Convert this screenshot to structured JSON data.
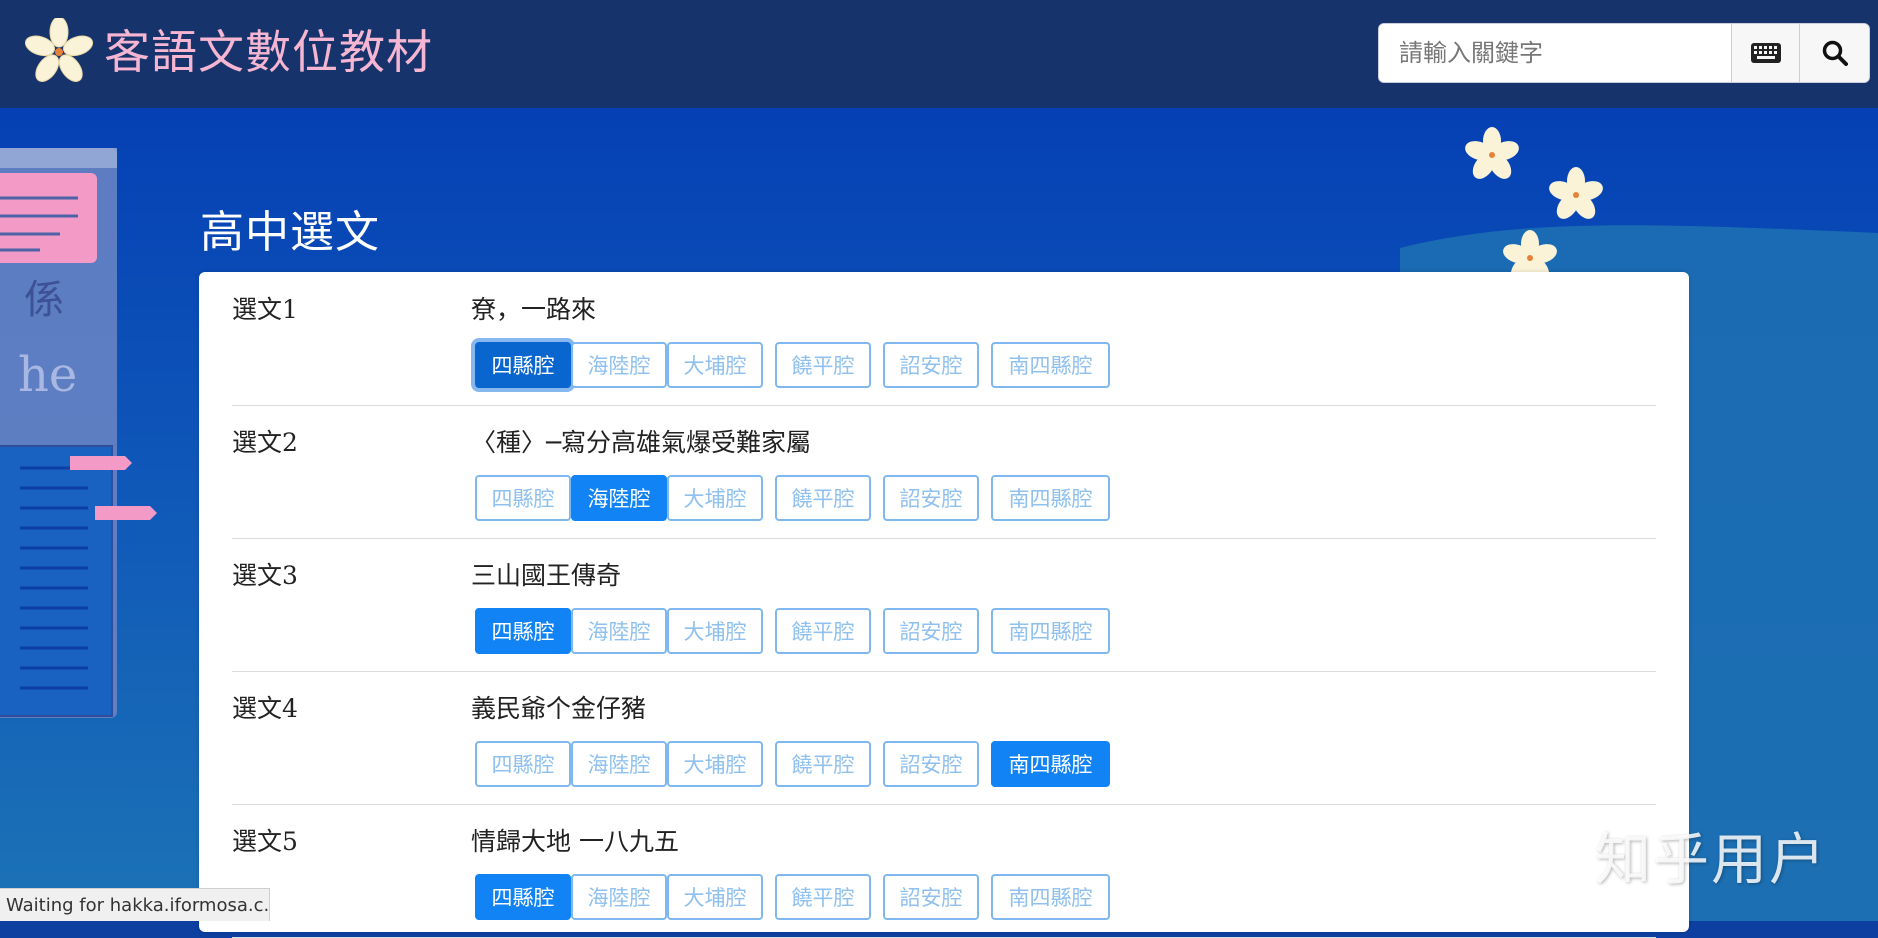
{
  "header": {
    "site_title": "客語文數位教材",
    "search": {
      "placeholder": "請輸入關鍵字",
      "value": ""
    }
  },
  "page": {
    "title": "高中選文",
    "rows": [
      {
        "num": "選文1",
        "title": "尞，一路來",
        "active": 0
      },
      {
        "num": "選文2",
        "title": "〈種〉─寫分高雄氣爆受難家屬",
        "active": 1
      },
      {
        "num": "選文3",
        "title": "三山國王傳奇",
        "active": 0
      },
      {
        "num": "選文4",
        "title": "義民爺个金仔豬",
        "active": 5
      },
      {
        "num": "選文5",
        "title": "情歸大地 一八九五",
        "active": 0
      }
    ],
    "dialects": [
      "四縣腔",
      "海陸腔",
      "大埔腔",
      "饒平腔",
      "詔安腔",
      "南四縣腔"
    ]
  },
  "deco": {
    "book_char": "係",
    "book_word": "he"
  },
  "statusbar": "Waiting for hakka.iformosa.c...",
  "watermark": "知乎用户",
  "colors": {
    "header_bg": "#16336b",
    "accent": "#1183f5",
    "title_pink": "#f6b6d2"
  },
  "icons": [
    "flower-logo-icon",
    "keyboard-icon",
    "search-icon"
  ]
}
